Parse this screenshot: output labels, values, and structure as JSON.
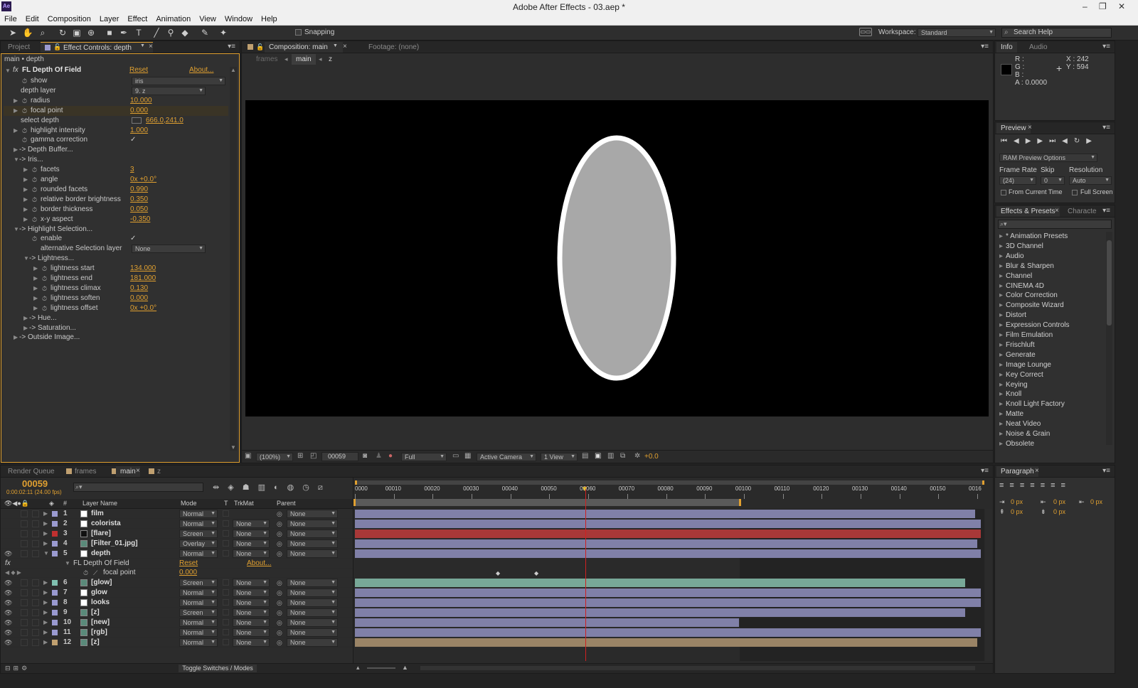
{
  "window": {
    "title": "Adobe After Effects - 03.aep *",
    "logo": "Ae"
  },
  "menu": [
    "File",
    "Edit",
    "Composition",
    "Layer",
    "Effect",
    "Animation",
    "View",
    "Window",
    "Help"
  ],
  "toolbar": {
    "snapping": "Snapping",
    "workspace_label": "Workspace:",
    "workspace_value": "Standard",
    "search_placeholder": "Search Help"
  },
  "left_panel": {
    "tabs": [
      "Project",
      "Effect Controls: depth"
    ],
    "breadcrumb": "main • depth",
    "effect_name": "FL Depth Of Field",
    "reset": "Reset",
    "about": "About...",
    "params": [
      {
        "label": "show",
        "value": "iris",
        "type": "dropdown",
        "indent": 0
      },
      {
        "label": "depth layer",
        "value": "9. z",
        "type": "dropdown",
        "indent": 0
      },
      {
        "label": "radius",
        "value": "10.000",
        "indent": 0
      },
      {
        "label": "focal point",
        "value": "0.000",
        "indent": 0
      },
      {
        "label": "select depth",
        "value": "666.0,241.0",
        "indent": 0
      },
      {
        "label": "highlight intensity",
        "value": "1.000",
        "indent": 0
      },
      {
        "label": "gamma correction",
        "value": "✓",
        "indent": 0
      },
      {
        "label": "-> Depth Buffer...",
        "value": "",
        "indent": 0
      },
      {
        "label": "-> Iris...",
        "value": "",
        "indent": 0
      },
      {
        "label": "facets",
        "value": "3",
        "indent": 1
      },
      {
        "label": "angle",
        "value": "0x +0.0°",
        "indent": 1
      },
      {
        "label": "rounded facets",
        "value": "0.990",
        "indent": 1
      },
      {
        "label": "relative border brightness",
        "value": "0.350",
        "indent": 1
      },
      {
        "label": "border thickness",
        "value": "0.050",
        "indent": 1
      },
      {
        "label": "x-y aspect",
        "value": "-0.350",
        "indent": 1
      },
      {
        "label": "-> Highlight Selection...",
        "value": "",
        "indent": 0
      },
      {
        "label": "enable",
        "value": "✓",
        "indent": 1
      },
      {
        "label": "alternative Selection layer",
        "value": "None",
        "type": "dropdown",
        "indent": 1
      },
      {
        "label": "-> Lightness...",
        "value": "",
        "indent": 1
      },
      {
        "label": "lightness start",
        "value": "134.000",
        "indent": 2
      },
      {
        "label": "lightness end",
        "value": "181.000",
        "indent": 2
      },
      {
        "label": "lightness climax",
        "value": "0.130",
        "indent": 2
      },
      {
        "label": "lightness soften",
        "value": "0.000",
        "indent": 2
      },
      {
        "label": "lightness offset",
        "value": "0x +0.0°",
        "indent": 2
      },
      {
        "label": "-> Hue...",
        "value": "",
        "indent": 1
      },
      {
        "label": "-> Saturation...",
        "value": "",
        "indent": 1
      },
      {
        "label": "-> Outside Image...",
        "value": "",
        "indent": 0
      }
    ]
  },
  "comp_panel": {
    "tabs": [
      "Composition: main",
      "Footage: (none)"
    ],
    "crumbs": [
      "frames",
      "main",
      "z"
    ],
    "footer": {
      "zoom": "(100%)",
      "timecode": "00059",
      "resolution": "Full",
      "camera": "Active Camera",
      "view": "1 View",
      "exposure": "+0.0"
    }
  },
  "info_panel": {
    "tabs": [
      "Info",
      "Audio"
    ],
    "r": "R :",
    "g": "G :",
    "b": "B :",
    "a": "A : 0.0000",
    "x": "X : 242",
    "y": "Y : 594"
  },
  "preview_panel": {
    "tab": "Preview",
    "ram_options": "RAM Preview Options",
    "frame_rate_label": "Frame Rate",
    "skip_label": "Skip",
    "resolution_label": "Resolution",
    "frame_rate": "(24)",
    "skip": "0",
    "resolution": "Auto",
    "from_current": "From Current Time",
    "full_screen": "Full Screen"
  },
  "effects_panel": {
    "tabs": [
      "Effects & Presets",
      "Characte"
    ],
    "items": [
      "* Animation Presets",
      "3D Channel",
      "Audio",
      "Blur & Sharpen",
      "Channel",
      "CINEMA 4D",
      "Color Correction",
      "Composite Wizard",
      "Distort",
      "Expression Controls",
      "Film Emulation",
      "Frischluft",
      "Generate",
      "Image Lounge",
      "Key Correct",
      "Keying",
      "Knoll",
      "Knoll Light Factory",
      "Matte",
      "Neat Video",
      "Noise & Grain",
      "Obsolete"
    ]
  },
  "paragraph_panel": {
    "tab": "Paragraph",
    "values": [
      "0 px",
      "0 px",
      "0 px",
      "0 px",
      "0 px"
    ]
  },
  "timeline": {
    "tabs": [
      "Render Queue",
      "frames",
      "main",
      "z"
    ],
    "timecode": "00059",
    "subtime": "0:00:02:11 (24.00 fps)",
    "headers": {
      "num": "#",
      "name": "Layer Name",
      "mode": "Mode",
      "t": "T",
      "trkmat": "TrkMat",
      "parent": "Parent"
    },
    "ruler": [
      "0000",
      "00010",
      "00020",
      "00030",
      "00040",
      "00050",
      "00060",
      "00070",
      "00080",
      "00090",
      "00100",
      "00110",
      "00120",
      "00130",
      "00140",
      "00150",
      "0016"
    ],
    "layers": [
      {
        "num": "1",
        "name": "film",
        "mode": "Normal",
        "trkmat": "",
        "parent": "None",
        "color": "#9a9ad0",
        "bar": "#8080a8"
      },
      {
        "num": "2",
        "name": "colorista",
        "mode": "Normal",
        "trkmat": "None",
        "parent": "None",
        "color": "#9a9ad0",
        "bar": "#8080a8"
      },
      {
        "num": "3",
        "name": "[flare]",
        "mode": "Screen",
        "trkmat": "None",
        "parent": "None",
        "color": "#c03030",
        "bar": "#a83838"
      },
      {
        "num": "4",
        "name": "[Filter_01.jpg]",
        "mode": "Overlay",
        "trkmat": "None",
        "parent": "None",
        "color": "#9a9ad0",
        "bar": "#8080a8"
      },
      {
        "num": "5",
        "name": "depth",
        "mode": "Normal",
        "trkmat": "None",
        "parent": "None",
        "color": "#9a9ad0",
        "bar": "#8080a8"
      },
      {
        "num": "6",
        "name": "[glow]",
        "mode": "Screen",
        "trkmat": "None",
        "parent": "None",
        "color": "#80c0b0",
        "bar": "#78a898"
      },
      {
        "num": "7",
        "name": "glow",
        "mode": "Normal",
        "trkmat": "None",
        "parent": "None",
        "color": "#9a9ad0",
        "bar": "#8080a8"
      },
      {
        "num": "8",
        "name": "looks",
        "mode": "Normal",
        "trkmat": "None",
        "parent": "None",
        "color": "#9a9ad0",
        "bar": "#8080a8"
      },
      {
        "num": "9",
        "name": "[z]",
        "mode": "Screen",
        "trkmat": "None",
        "parent": "None",
        "color": "#9a9ad0",
        "bar": "#8080a8"
      },
      {
        "num": "10",
        "name": "[new]",
        "mode": "Normal",
        "trkmat": "None",
        "parent": "None",
        "color": "#9a9ad0",
        "bar": "#8080a8"
      },
      {
        "num": "11",
        "name": "[rgb]",
        "mode": "Normal",
        "trkmat": "None",
        "parent": "None",
        "color": "#9a9ad0",
        "bar": "#8080a8"
      },
      {
        "num": "12",
        "name": "[z]",
        "mode": "Normal",
        "trkmat": "None",
        "parent": "None",
        "color": "#c0a070",
        "bar": "#9a8466"
      }
    ],
    "effect_row": {
      "name": "FL Depth Of Field",
      "reset": "Reset",
      "about": "About..."
    },
    "focal_row": {
      "name": "focal point",
      "value": "0.000"
    },
    "toggle": "Toggle Switches / Modes"
  }
}
